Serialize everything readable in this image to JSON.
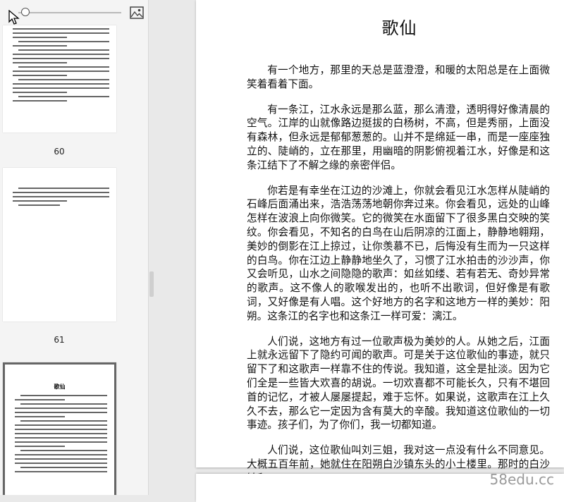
{
  "sidebar": {
    "thumbnails": [
      {
        "page_label": "60"
      },
      {
        "page_label": "61"
      },
      {
        "title": "歌仙"
      }
    ]
  },
  "icons": {
    "image": "image-icon",
    "cursor": "mouse-pointer-icon"
  },
  "document": {
    "title": "歌仙",
    "paragraphs": [
      "有一个地方，那里的天总是蓝澄澄，和暖的太阳总是在上面微笑着看着下面。",
      "有一条江，江水永远是那么蓝，那么清澄，透明得好像清晨的空气。江岸的山就像路边挺拔的白杨树，不高，但是秀丽，上面没有森林，但永远是郁郁葱葱的。山并不是绵延一串，而是一座座独立的、陡峭的，立在那里，用幽暗的阴影俯视着江水，好像是和这条江结下了不解之缘的亲密伴侣。",
      "你若是有幸坐在江边的沙滩上，你就会看见江水怎样从陡峭的石峰后面涌出来，浩浩荡荡地朝你奔过来。你会看见，远处的山峰怎样在波浪上向你微笑。它的微笑在水面留下了很多黑白交映的笑纹。你会看见，不知名的白鸟在山后阴凉的江面上，静静地翱翔，美妙的倒影在江上掠过，让你羡慕不已，后悔没有生而为一只这样的白鸟。你在江边上静静地坐久了，习惯了江水拍击的沙沙声，你又会听见，山水之间隐隐的歌声：如丝如缕、若有若无、奇妙异常的歌声。这不像人的歌喉发出的，也听不出歌词，但好像是有歌词，又好像是有人唱。这个好地方的名字和这地方一样的美妙：阳朔。这条江的名字也和这条江一样可爱：漓江。",
      "人们说，这地方有过一位歌声极为美妙的人。从她之后，江面上就永远留下了隐约可闻的歌声。可是关于这位歌仙的事迹，就只留下了和这歌声一样靠不住的传说。我知道，这全是扯淡。因为它们全是一些皆大欢喜的胡说。一切欢喜都不可能长久，只有不堪回首的记忆，才被人屡屡提起，难于忘怀。如果说，这歌声在江上久久不去，那么它一定因为含有莫大的辛酸。我知道这位歌仙的一切事迹。孩子们，为了你们，我一切都知道。",
      "人们说，这位歌仙叫刘三姐，我对这一点没有什么不同意见。大概五百年前，她就住在阳朔白沙镇东头的小土楼里。那时的白沙镇和"
    ]
  },
  "watermark": "58edu.cc"
}
